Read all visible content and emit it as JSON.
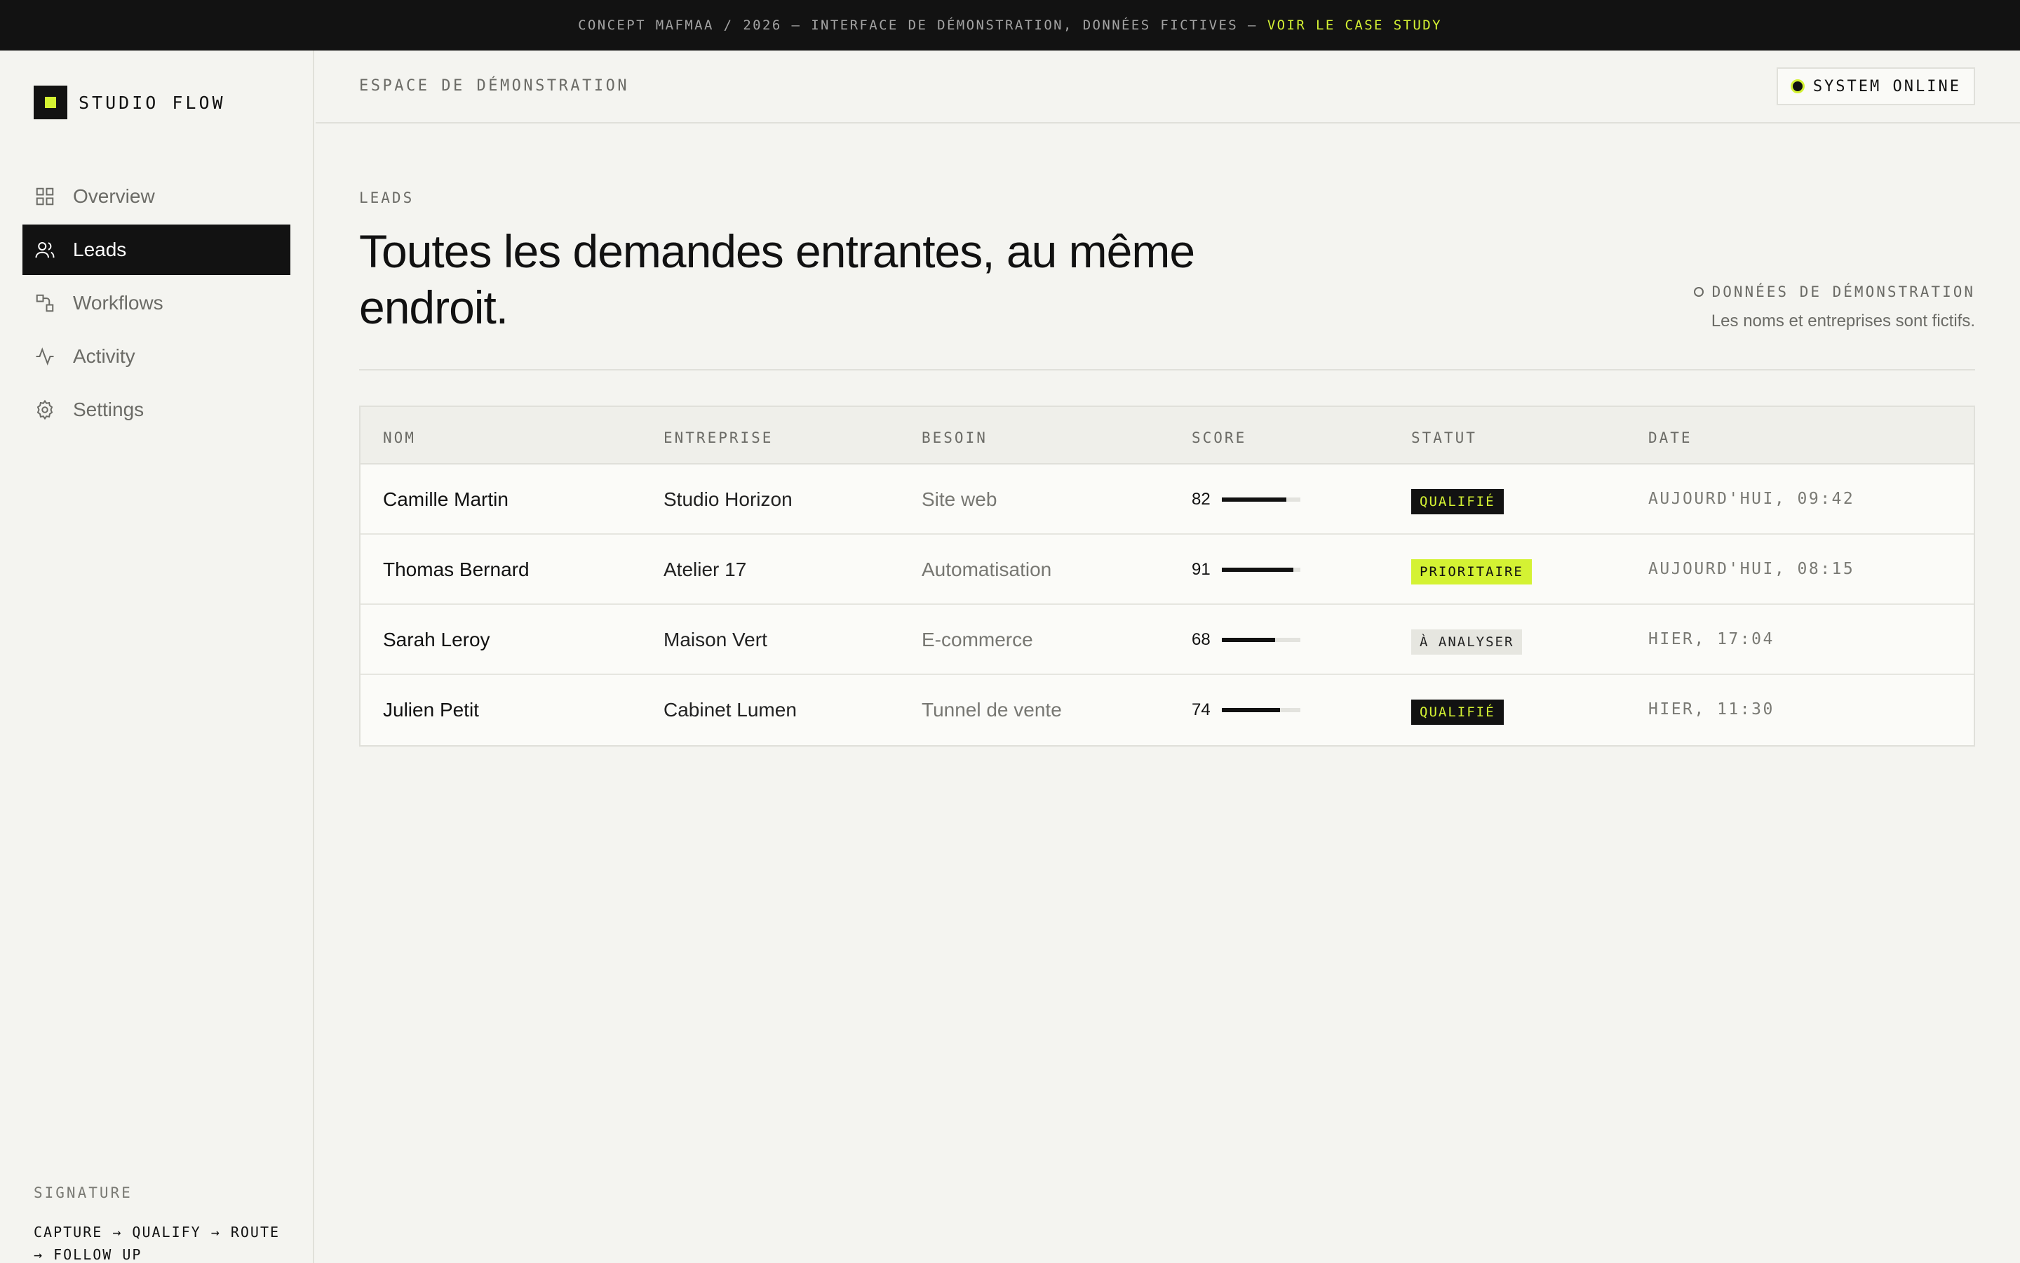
{
  "banner": {
    "text": "CONCEPT MAFMAA / 2026 — INTERFACE DE DÉMONSTRATION, DONNÉES FICTIVES —",
    "cta": "VOIR LE CASE STUDY"
  },
  "brand": {
    "name": "STUDIO FLOW"
  },
  "sidebar": {
    "items": [
      {
        "label": "Overview",
        "icon": "grid-icon",
        "active": false
      },
      {
        "label": "Leads",
        "icon": "users-icon",
        "active": true
      },
      {
        "label": "Workflows",
        "icon": "workflow-icon",
        "active": false
      },
      {
        "label": "Activity",
        "icon": "activity-icon",
        "active": false
      },
      {
        "label": "Settings",
        "icon": "gear-icon",
        "active": false
      }
    ],
    "signature": {
      "title": "SIGNATURE",
      "text": "CAPTURE → QUALIFY → ROUTE → FOLLOW UP"
    }
  },
  "header": {
    "workspace": "ESPACE DE DÉMONSTRATION",
    "status": "SYSTEM ONLINE"
  },
  "main": {
    "eyebrow": "LEADS",
    "title": "Toutes les demandes entrantes, au même endroit.",
    "demo_flag": "DONNÉES DE DÉMONSTRATION",
    "demo_sub": "Les noms et entreprises sont fictifs."
  },
  "table": {
    "columns": [
      "NOM",
      "ENTREPRISE",
      "BESOIN",
      "SCORE",
      "STATUT",
      "DATE"
    ],
    "rows": [
      {
        "nom": "Camille Martin",
        "entreprise": "Studio Horizon",
        "besoin": "Site web",
        "score": 82,
        "statut": "QUALIFIÉ",
        "statut_type": "qualified",
        "date": "AUJOURD'HUI, 09:42"
      },
      {
        "nom": "Thomas Bernard",
        "entreprise": "Atelier 17",
        "besoin": "Automatisation",
        "score": 91,
        "statut": "PRIORITAIRE",
        "statut_type": "priority",
        "date": "AUJOURD'HUI, 08:15"
      },
      {
        "nom": "Sarah Leroy",
        "entreprise": "Maison Vert",
        "besoin": "E-commerce",
        "score": 68,
        "statut": "À ANALYSER",
        "statut_type": "pending",
        "date": "HIER, 17:04"
      },
      {
        "nom": "Julien Petit",
        "entreprise": "Cabinet Lumen",
        "besoin": "Tunnel de vente",
        "score": 74,
        "statut": "QUALIFIÉ",
        "statut_type": "qualified",
        "date": "HIER, 11:30"
      }
    ]
  },
  "colors": {
    "accent": "#d4f233",
    "dark": "#121212",
    "background": "#f4f4f0"
  }
}
